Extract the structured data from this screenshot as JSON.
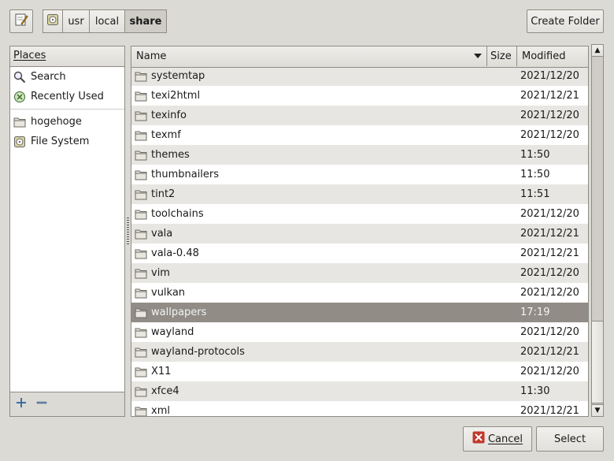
{
  "toolbar": {
    "edit_icon": "pencil-note-icon",
    "path": [
      {
        "label": "",
        "icon": "filesystem-icon"
      },
      {
        "label": "usr"
      },
      {
        "label": "local"
      },
      {
        "label": "share",
        "active": true
      }
    ],
    "create_folder_label": "Create Folder"
  },
  "places": {
    "header": "Places",
    "items": [
      {
        "label": "Search",
        "icon": "search-icon"
      },
      {
        "label": "Recently Used",
        "icon": "recent-icon"
      },
      {
        "label": "hogehoge",
        "icon": "folder-icon"
      },
      {
        "label": "File System",
        "icon": "filesystem-icon"
      }
    ],
    "add_icon": "plus-icon",
    "remove_icon": "minus-icon"
  },
  "files": {
    "columns": {
      "name": "Name",
      "size": "Size",
      "modified": "Modified"
    },
    "rows": [
      {
        "name": "systemtap",
        "size": "",
        "modified": "2021/12/20"
      },
      {
        "name": "texi2html",
        "size": "",
        "modified": "2021/12/21"
      },
      {
        "name": "texinfo",
        "size": "",
        "modified": "2021/12/20"
      },
      {
        "name": "texmf",
        "size": "",
        "modified": "2021/12/20"
      },
      {
        "name": "themes",
        "size": "",
        "modified": "11:50"
      },
      {
        "name": "thumbnailers",
        "size": "",
        "modified": "11:50"
      },
      {
        "name": "tint2",
        "size": "",
        "modified": "11:51"
      },
      {
        "name": "toolchains",
        "size": "",
        "modified": "2021/12/20"
      },
      {
        "name": "vala",
        "size": "",
        "modified": "2021/12/21"
      },
      {
        "name": "vala-0.48",
        "size": "",
        "modified": "2021/12/21"
      },
      {
        "name": "vim",
        "size": "",
        "modified": "2021/12/20"
      },
      {
        "name": "vulkan",
        "size": "",
        "modified": "2021/12/20"
      },
      {
        "name": "wallpapers",
        "size": "",
        "modified": "17:19",
        "selected": true
      },
      {
        "name": "wayland",
        "size": "",
        "modified": "2021/12/20"
      },
      {
        "name": "wayland-protocols",
        "size": "",
        "modified": "2021/12/21"
      },
      {
        "name": "X11",
        "size": "",
        "modified": "2021/12/20"
      },
      {
        "name": "xfce4",
        "size": "",
        "modified": "11:30"
      },
      {
        "name": "xml",
        "size": "",
        "modified": "2021/12/21"
      }
    ]
  },
  "buttons": {
    "cancel_label": "Cancel",
    "select_label": "Select"
  },
  "colors": {
    "window_bg": "#dcdad5",
    "selection": "#918d86",
    "stripe": "#e7e6e2"
  }
}
